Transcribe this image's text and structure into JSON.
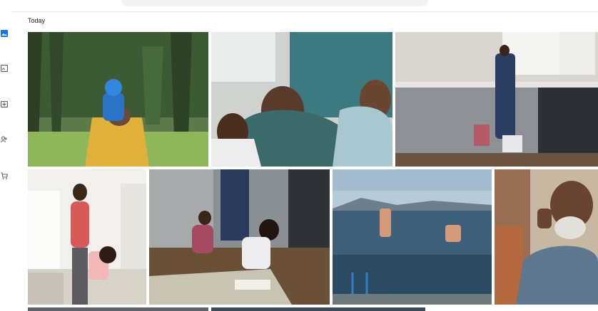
{
  "section": {
    "title": "Today"
  },
  "nav_icons": [
    "photos-icon",
    "albums-icon",
    "create-icon",
    "sharing-icon",
    "print-store-icon"
  ],
  "photos": [
    {
      "name": "photo-hiking-child"
    },
    {
      "name": "photo-family-laughing"
    },
    {
      "name": "photo-kitchen-family"
    },
    {
      "name": "photo-mother-daughter"
    },
    {
      "name": "photo-kids-playing-floor"
    },
    {
      "name": "photo-lake-jump"
    },
    {
      "name": "photo-man-laughing"
    }
  ],
  "colors": {
    "accent": "#1a73e8",
    "text": "#202124",
    "icon": "#5f6368"
  }
}
